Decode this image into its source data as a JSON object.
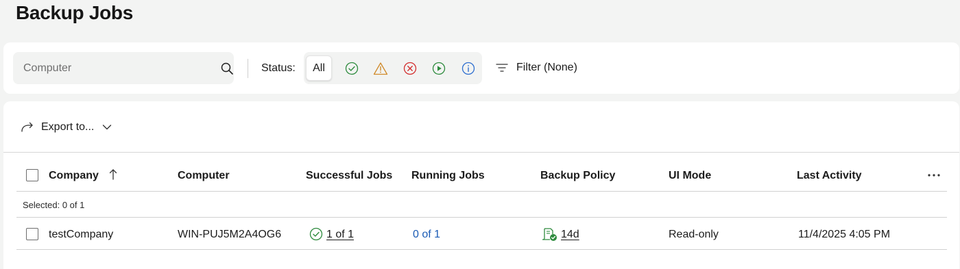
{
  "page": {
    "title": "Backup Jobs"
  },
  "filters": {
    "search_placeholder": "Computer",
    "status_label": "Status:",
    "status_options": [
      {
        "label": "All",
        "selected": true
      },
      {
        "icon": "check-circle-icon",
        "color": "#2e8b3e"
      },
      {
        "icon": "warning-triangle-icon",
        "color": "#d08a2a"
      },
      {
        "icon": "error-circle-icon",
        "color": "#d32f2f"
      },
      {
        "icon": "play-circle-icon",
        "color": "#2e8b3e"
      },
      {
        "icon": "info-circle-icon",
        "color": "#2f6fd0"
      }
    ],
    "filter_label": "Filter (None)"
  },
  "toolbar": {
    "export_label": "Export to..."
  },
  "table": {
    "columns": [
      "Company",
      "Computer",
      "Successful Jobs",
      "Running Jobs",
      "Backup Policy",
      "UI Mode",
      "Last Activity"
    ],
    "sort": {
      "column": "Company",
      "direction": "ascending"
    },
    "selected_text": "Selected: 0 of 1",
    "rows": [
      {
        "company": "testCompany",
        "computer": "WIN-PUJ5M2A4OG6",
        "successful_jobs": "1 of 1",
        "running_jobs": "0 of 1",
        "backup_policy": "14d",
        "ui_mode": "Read-only",
        "last_activity": "11/4/2025 4:05 PM"
      }
    ]
  },
  "colors": {
    "link_blue": "#1a5bb5",
    "success_green": "#2e8b3e",
    "warning_orange": "#d08a2a",
    "error_red": "#d32f2f",
    "info_blue": "#2f6fd0"
  }
}
